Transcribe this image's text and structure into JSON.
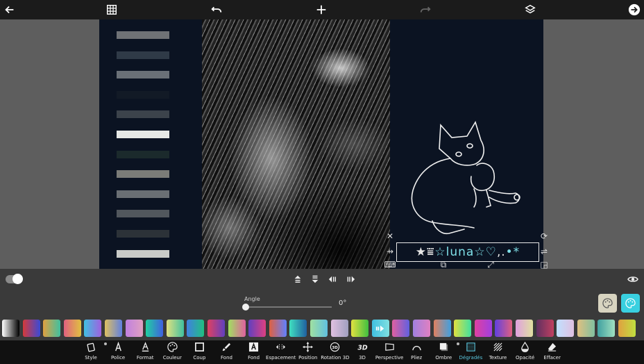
{
  "topbar": {
    "icons": [
      "back-arrow-icon",
      "grid-icon",
      "undo-icon",
      "add-icon",
      "redo-icon",
      "layers-icon",
      "next-icon"
    ]
  },
  "design": {
    "stripe_colors": [
      "#6f7276",
      "#2f3a47",
      "#6a7077",
      "#121a26",
      "#3c434b",
      "#e6e8e6",
      "#1b2a2c",
      "#7b7c78",
      "#6a6f74",
      "#51575d",
      "#2c3238",
      "#c9cbc8"
    ],
    "text_layer": {
      "parts": [
        {
          "t": "★",
          "c": "light"
        },
        {
          "t": "⩸",
          "c": "light"
        },
        {
          "t": " ☆ ",
          "c": "cyan"
        },
        {
          "t": "luna",
          "c": "cyan"
        },
        {
          "t": " ☆ ",
          "c": "cyan"
        },
        {
          "t": "♡",
          "c": "cyan"
        },
        {
          "t": "‚.",
          "c": "light"
        },
        {
          "t": "•*",
          "c": "cyan"
        }
      ]
    }
  },
  "controls": {
    "toggle_on": true
  },
  "angle": {
    "label": "Angle",
    "value": "0°",
    "fraction": 0.0
  },
  "gradients": [
    [
      "#ffffff",
      "#000000"
    ],
    [
      "#d63a3a",
      "#3a4ad6"
    ],
    [
      "#e0a040",
      "#40c0a0"
    ],
    [
      "#e06080",
      "#e0c040"
    ],
    [
      "#40c0e0",
      "#a060e0"
    ],
    [
      "#e0c060",
      "#6080e0"
    ],
    [
      "#c080e0",
      "#e0a0c0"
    ],
    [
      "#20d0a0",
      "#4060e0"
    ],
    [
      "#e0e080",
      "#40c0a0"
    ],
    [
      "#4080e0",
      "#20c080"
    ],
    [
      "#e04060",
      "#6040c0"
    ],
    [
      "#a0e060",
      "#e060a0"
    ],
    [
      "#6040c0",
      "#e04080"
    ],
    [
      "#e06040",
      "#6080ff"
    ],
    [
      "#40e0c0",
      "#2060a0"
    ],
    [
      "#a0e0a0",
      "#60c0e0"
    ],
    [
      "#e0c0e0",
      "#a0a0c0"
    ],
    [
      "#e0e040",
      "#40c040"
    ],
    [
      "#40c0e0",
      "#80e0e0"
    ],
    [
      "#e060a0",
      "#6060e0"
    ],
    [
      "#a080e0",
      "#e080c0"
    ],
    [
      "#e08060",
      "#40a0e0"
    ],
    [
      "#e0e040",
      "#40e0a0"
    ],
    [
      "#e040a0",
      "#a040e0"
    ],
    [
      "#6040e0",
      "#e06080"
    ],
    [
      "#e0a0e0",
      "#e0e0a0"
    ],
    [
      "#603060",
      "#c04060"
    ],
    [
      "#c0e0ff",
      "#e0c0e0"
    ],
    [
      "#e0c080",
      "#80c0a0"
    ],
    [
      "#40a0a0",
      "#a0e0c0"
    ],
    [
      "#e0a040",
      "#c0e040"
    ]
  ],
  "tools": [
    {
      "label": "Style",
      "icon": "style-icon",
      "dot": false
    },
    {
      "label": "Police",
      "icon": "font-icon",
      "dot": true
    },
    {
      "label": "Format",
      "icon": "format-icon",
      "dot": false
    },
    {
      "label": "Couleur",
      "icon": "palette-icon",
      "dot": false
    },
    {
      "label": "Coup",
      "icon": "stroke-icon",
      "dot": false
    },
    {
      "label": "Fond",
      "icon": "brush-icon",
      "dot": false
    },
    {
      "label": "Fond",
      "icon": "background-icon",
      "dot": false
    },
    {
      "label": "Espacement",
      "icon": "spacing-icon",
      "dot": false
    },
    {
      "label": "Position",
      "icon": "move-icon",
      "dot": false
    },
    {
      "label": "Rotation 3D",
      "icon": "rotation-3d-icon",
      "dot": false
    },
    {
      "label": "3D",
      "icon": "3d-icon",
      "dot": false
    },
    {
      "label": "Perspective",
      "icon": "perspective-icon",
      "dot": false
    },
    {
      "label": "Pliez",
      "icon": "curve-icon",
      "dot": false
    },
    {
      "label": "Ombre",
      "icon": "shadow-icon",
      "dot": false
    },
    {
      "label": "Dégradés",
      "icon": "gradient-icon",
      "dot": true,
      "active": true
    },
    {
      "label": "Texture",
      "icon": "texture-icon",
      "dot": false
    },
    {
      "label": "Opacité",
      "icon": "opacity-icon",
      "dot": false
    },
    {
      "label": "Effacer",
      "icon": "eraser-icon",
      "dot": false
    }
  ],
  "colors": {
    "accent": "#5bc8e0",
    "palette_btn_1": "#d8d4c0",
    "palette_btn_2": "#39d0e0"
  }
}
